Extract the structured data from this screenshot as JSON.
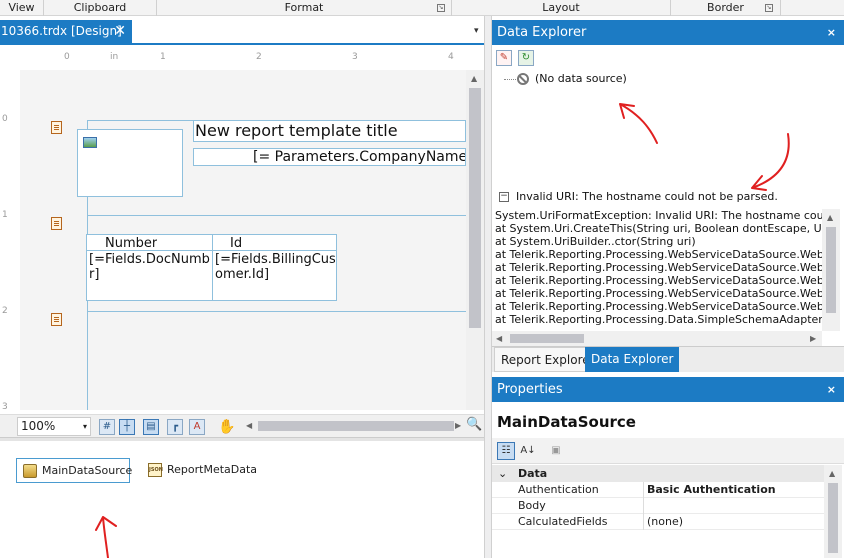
{
  "ribbon": {
    "groups": [
      "View",
      "Clipboard",
      "Format",
      "Layout",
      "Border"
    ]
  },
  "document": {
    "tab_label": "10366.trdx [Design]",
    "tab_close": "✕",
    "dropdown_glyph": "▾"
  },
  "ruler": {
    "top_ticks": [
      "0",
      "in",
      "1",
      "2",
      "3",
      "4"
    ],
    "left_ticks": [
      "0",
      "1",
      "2",
      "3"
    ]
  },
  "report": {
    "title_text": "New report template title",
    "parameter_text": "[= Parameters.CompanyName.V",
    "table": {
      "headers": [
        "Number",
        "Id"
      ],
      "cells": [
        "[=Fields.DocNumbe r]",
        "[=Fields.BillingCust omer.Id]"
      ]
    }
  },
  "zoom": {
    "value": "100%",
    "dropdown_glyph": "▾"
  },
  "tray": {
    "items": [
      "MainDataSource",
      "ReportMetaData"
    ]
  },
  "data_explorer": {
    "title": "Data Explorer",
    "close_glyph": "×",
    "tree_item": "(No data source)",
    "error_toggle": "−",
    "error_title": "Invalid URI: The hostname could not be parsed.",
    "error_lines": [
      "System.UriFormatException: Invalid URI: The hostname could no",
      "   at System.Uri.CreateThis(String uri, Boolean dontEscape, UriKi",
      "   at System.UriBuilder..ctor(String uri)",
      "   at Telerik.Reporting.Processing.WebServiceDataSource.WebSe",
      "   at Telerik.Reporting.Processing.WebServiceDataSource.WebSe",
      "   at Telerik.Reporting.Processing.WebServiceDataSource.WebSe",
      "   at Telerik.Reporting.Processing.WebServiceDataSource.WebSe",
      "   at Telerik.Reporting.Processing.WebServiceDataSource.WebSe",
      "   at Telerik.Reporting.Processing.Data.SimpleSchemaAdapterBa"
    ]
  },
  "panel_tabs": [
    "Report Explorer",
    "Data Explorer"
  ],
  "properties": {
    "title": "Properties",
    "close_glyph": "×",
    "object_name": "MainDataSource",
    "category": "Data",
    "rows": [
      {
        "name": "Authentication",
        "value": "Basic Authentication"
      },
      {
        "name": "Body",
        "value": ""
      },
      {
        "name": "CalculatedFields",
        "value": "(none)"
      }
    ]
  },
  "colors": {
    "accent": "#1c7bc4",
    "annotation": "#e02020"
  }
}
